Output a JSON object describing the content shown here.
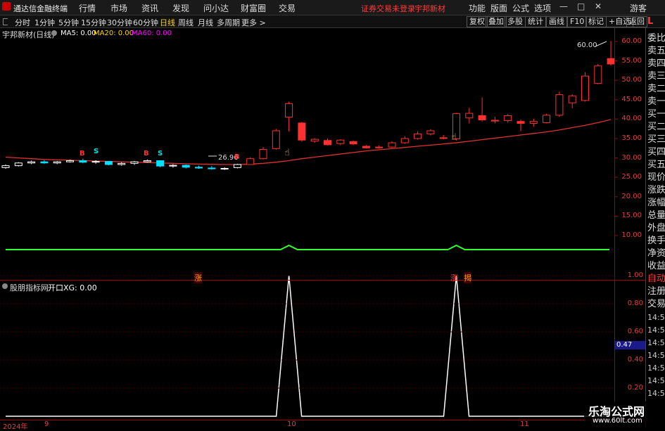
{
  "menu": {
    "app_title": "通达信金融终端",
    "items": [
      "行情",
      "市场",
      "资讯",
      "发现",
      "问小达",
      "财富圈",
      "交易"
    ],
    "status_login": "证券交易未登录",
    "status_stock": "宇邦新材",
    "right_items": [
      "功能",
      "版面",
      "公式",
      "选项"
    ],
    "guest": "游客",
    "win_min": "—",
    "win_max": "□",
    "win_close": "✕"
  },
  "toolbar": {
    "periods": [
      "分时",
      "1分钟",
      "5分钟",
      "15分钟",
      "30分钟",
      "60分钟",
      "日线",
      "周线",
      "月线",
      "多周期",
      "更多 >"
    ],
    "active_period": "日线",
    "buttons": [
      "复权",
      "叠加",
      "多股",
      "统计",
      "画线",
      "F10",
      "标记",
      "+自选",
      "返回"
    ]
  },
  "main_chart": {
    "title": "宇邦新材(日线)",
    "ma5": "MA5: 0.00",
    "ma20": "MA20: 0.00",
    "ma60": "MA60: 0.00",
    "high_label": "60.00",
    "low_label": "26.96",
    "y_ticks": [
      "60.00",
      "55.00",
      "50.00",
      "45.00",
      "40.00",
      "35.00",
      "30.00",
      "25.00",
      "20.00",
      "15.00",
      "10.00"
    ],
    "markers": [
      "B",
      "S",
      "B",
      "S",
      "B",
      "S",
      "B"
    ],
    "signal_labels": [
      "涨",
      "涨",
      "揭"
    ]
  },
  "sub_chart": {
    "title": "股朋指标网",
    "indicator": "开口XG: 0.00",
    "y_ticks": [
      "1.00",
      "0.80",
      "0.60",
      "0.40",
      "0.20"
    ],
    "current_value": "0.47"
  },
  "x_axis": {
    "year": "2024年",
    "labels": [
      "9",
      "10",
      "11"
    ]
  },
  "sidebar": {
    "top_letter": "L",
    "items": [
      "委比",
      "卖五",
      "卖四",
      "卖三",
      "卖二",
      "卖一",
      "买一",
      "买二",
      "买三",
      "买四",
      "买五",
      "现价",
      "涨跌",
      "涨幅",
      "总量",
      "外盘",
      "换手",
      "净资",
      "收益",
      "自动",
      "注册",
      "交易"
    ],
    "times": [
      "14:56",
      "14:56",
      "14:56",
      "14:56",
      "14:56",
      "14:56",
      "14:56"
    ]
  },
  "watermark": {
    "title": "乐淘公式网",
    "url": "www.60lt.com"
  },
  "chart_data": {
    "type": "candlestick",
    "title": "宇邦新材(日线)",
    "ylim": [
      10,
      60
    ],
    "candles": [
      {
        "o": 27.5,
        "h": 28.3,
        "l": 27.2,
        "c": 28.0
      },
      {
        "o": 28.0,
        "h": 28.9,
        "l": 27.8,
        "c": 28.7
      },
      {
        "o": 28.7,
        "h": 29.3,
        "l": 28.4,
        "c": 29.0
      },
      {
        "o": 29.0,
        "h": 29.4,
        "l": 28.5,
        "c": 28.7
      },
      {
        "o": 28.7,
        "h": 29.2,
        "l": 28.4,
        "c": 29.0
      },
      {
        "o": 29.0,
        "h": 29.6,
        "l": 28.8,
        "c": 29.3
      },
      {
        "o": 29.3,
        "h": 29.8,
        "l": 28.6,
        "c": 28.9
      },
      {
        "o": 28.9,
        "h": 29.4,
        "l": 28.5,
        "c": 29.1
      },
      {
        "o": 29.1,
        "h": 29.2,
        "l": 28.1,
        "c": 28.3
      },
      {
        "o": 28.3,
        "h": 28.9,
        "l": 28.0,
        "c": 28.6
      },
      {
        "o": 28.6,
        "h": 29.2,
        "l": 28.2,
        "c": 29.0
      },
      {
        "o": 29.0,
        "h": 29.6,
        "l": 28.8,
        "c": 29.3
      },
      {
        "o": 29.3,
        "h": 29.4,
        "l": 27.6,
        "c": 27.9
      },
      {
        "o": 27.9,
        "h": 28.4,
        "l": 27.5,
        "c": 28.1
      },
      {
        "o": 28.1,
        "h": 28.3,
        "l": 27.3,
        "c": 27.6
      },
      {
        "o": 27.6,
        "h": 28.0,
        "l": 27.2,
        "c": 27.4
      },
      {
        "o": 27.4,
        "h": 27.9,
        "l": 27.0,
        "c": 27.2
      },
      {
        "o": 27.2,
        "h": 27.6,
        "l": 26.9,
        "c": 27.3
      },
      {
        "o": 27.5,
        "h": 28.5,
        "l": 27.3,
        "c": 28.3
      },
      {
        "o": 28.3,
        "h": 30.2,
        "l": 28.2,
        "c": 29.8
      },
      {
        "o": 29.8,
        "h": 32.8,
        "l": 29.6,
        "c": 32.2
      },
      {
        "o": 32.4,
        "h": 37.5,
        "l": 32.1,
        "c": 37.0
      },
      {
        "o": 40.5,
        "h": 44.5,
        "l": 36.8,
        "c": 44.0
      },
      {
        "o": 39.0,
        "h": 39.3,
        "l": 34.2,
        "c": 34.6
      },
      {
        "o": 34.3,
        "h": 35.1,
        "l": 33.9,
        "c": 34.8
      },
      {
        "o": 34.5,
        "h": 35.0,
        "l": 33.2,
        "c": 33.4
      },
      {
        "o": 33.7,
        "h": 34.8,
        "l": 33.3,
        "c": 34.6
      },
      {
        "o": 34.2,
        "h": 34.5,
        "l": 33.3,
        "c": 33.6
      },
      {
        "o": 33.0,
        "h": 33.3,
        "l": 32.4,
        "c": 32.6
      },
      {
        "o": 32.6,
        "h": 33.2,
        "l": 32.4,
        "c": 32.8
      },
      {
        "o": 32.8,
        "h": 34.3,
        "l": 32.6,
        "c": 33.9
      },
      {
        "o": 33.9,
        "h": 35.6,
        "l": 33.6,
        "c": 35.0
      },
      {
        "o": 35.0,
        "h": 36.9,
        "l": 34.7,
        "c": 36.2
      },
      {
        "o": 36.2,
        "h": 37.4,
        "l": 35.8,
        "c": 37.0
      },
      {
        "o": 35.2,
        "h": 35.9,
        "l": 34.8,
        "c": 35.1
      },
      {
        "o": 34.9,
        "h": 41.6,
        "l": 34.5,
        "c": 41.4
      },
      {
        "o": 40.3,
        "h": 42.9,
        "l": 38.9,
        "c": 41.5
      },
      {
        "o": 40.9,
        "h": 45.6,
        "l": 39.4,
        "c": 39.8
      },
      {
        "o": 39.5,
        "h": 40.6,
        "l": 38.9,
        "c": 39.7
      },
      {
        "o": 39.6,
        "h": 41.3,
        "l": 39.1,
        "c": 40.9
      },
      {
        "o": 39.4,
        "h": 39.9,
        "l": 36.9,
        "c": 38.9
      },
      {
        "o": 38.9,
        "h": 40.1,
        "l": 38.0,
        "c": 39.4
      },
      {
        "o": 39.1,
        "h": 41.4,
        "l": 38.9,
        "c": 41.0
      },
      {
        "o": 41.0,
        "h": 47.1,
        "l": 40.6,
        "c": 46.3
      },
      {
        "o": 44.2,
        "h": 46.4,
        "l": 42.8,
        "c": 46.0
      },
      {
        "o": 44.8,
        "h": 52.1,
        "l": 44.5,
        "c": 51.1
      },
      {
        "o": 49.2,
        "h": 54.2,
        "l": 49.0,
        "c": 53.7
      },
      {
        "o": 55.6,
        "h": 60.1,
        "l": 53.8,
        "c": 54.2
      }
    ],
    "ma_line": [
      30.2,
      30.0,
      29.8,
      29.6,
      29.5,
      29.4,
      29.3,
      29.2,
      29.1,
      29.0,
      28.9,
      28.8,
      28.7,
      28.6,
      28.5,
      28.4,
      28.35,
      28.3,
      28.3,
      28.4,
      28.6,
      28.9,
      29.3,
      29.8,
      30.2,
      30.6,
      31.0,
      31.4,
      31.8,
      32.1,
      32.4,
      32.7,
      33.0,
      33.3,
      33.6,
      33.9,
      34.3,
      34.7,
      35.1,
      35.5,
      35.9,
      36.3,
      36.7,
      37.2,
      37.8,
      38.4,
      39.1,
      39.9
    ],
    "xg_values": [
      0,
      0,
      0,
      0,
      0,
      0,
      0,
      0,
      0,
      0,
      0,
      0,
      0,
      0,
      0,
      0,
      0,
      0,
      0,
      0,
      0,
      0,
      1,
      0,
      0,
      0,
      0,
      0,
      0,
      0,
      0,
      0,
      0,
      0,
      0,
      1,
      0,
      0,
      0,
      0,
      0,
      0,
      0,
      0,
      0,
      0,
      0,
      0
    ]
  }
}
